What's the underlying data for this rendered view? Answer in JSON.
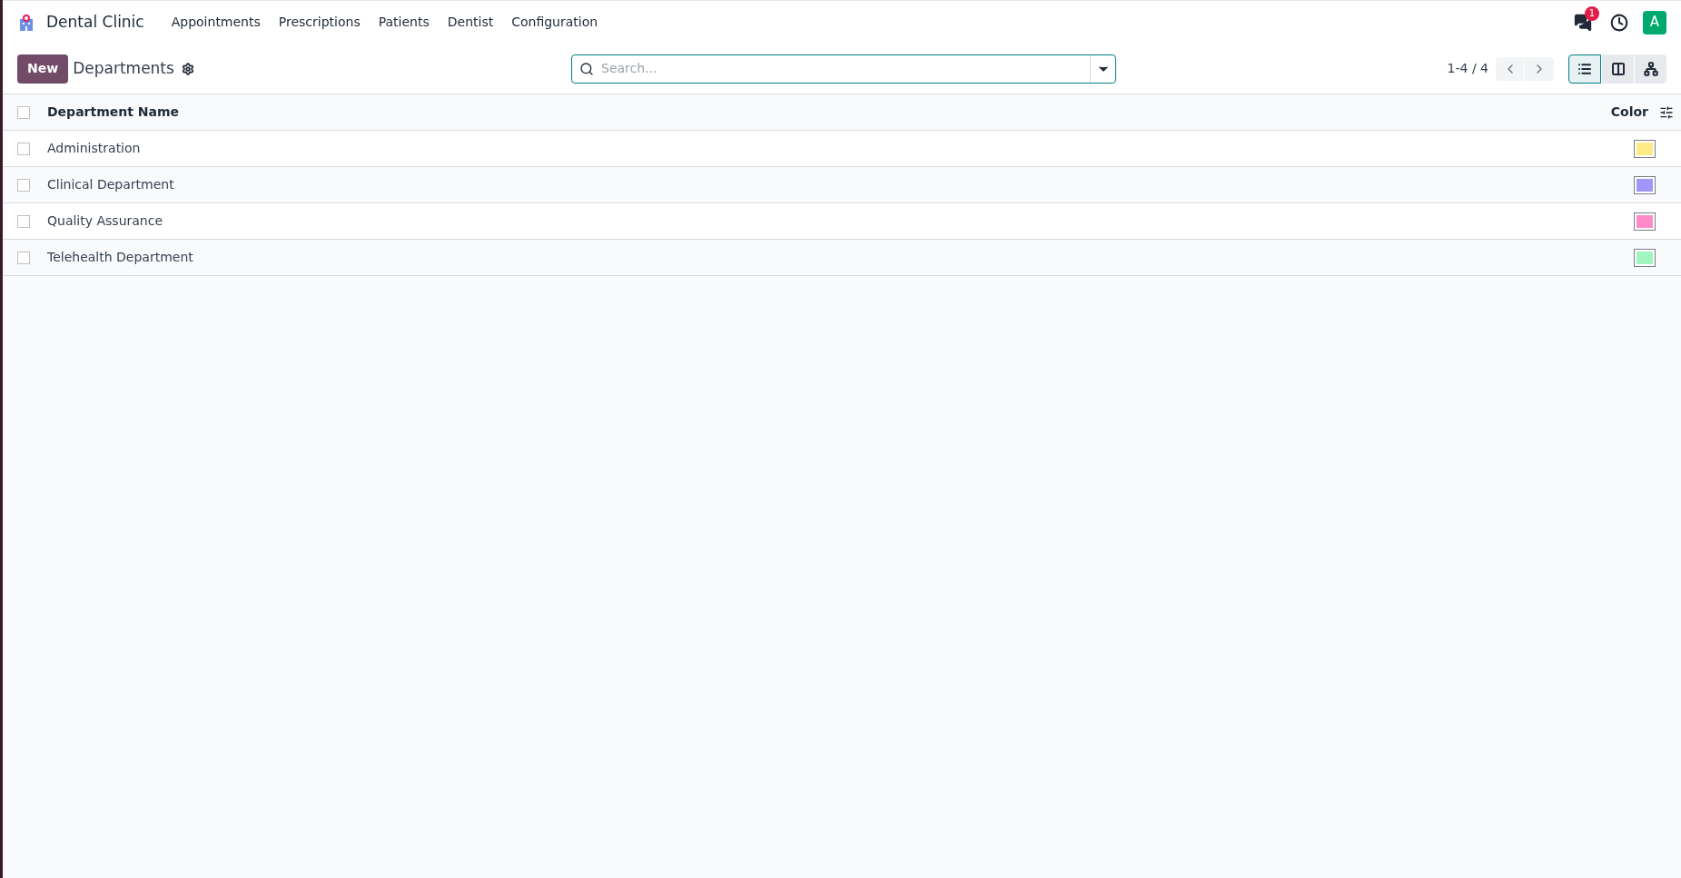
{
  "navbar": {
    "app_name": "Dental Clinic",
    "menu": [
      "Appointments",
      "Prescriptions",
      "Patients",
      "Dentist",
      "Configuration"
    ],
    "message_count": "1",
    "avatar": "A"
  },
  "control_panel": {
    "new_button": "New",
    "title": "Departments",
    "search": {
      "placeholder": "Search..."
    },
    "pager": "1-4 / 4",
    "views": [
      {
        "kind": "list",
        "selected": true
      },
      {
        "kind": "kanban",
        "selected": false
      },
      {
        "kind": "hierarchy",
        "selected": false
      }
    ]
  },
  "table": {
    "columns": [
      "Department Name",
      "Color"
    ],
    "header_checked": false,
    "rows": [
      {
        "name": "Administration",
        "checked": false,
        "color": "#ffeb85"
      },
      {
        "name": "Clinical Department",
        "checked": false,
        "color": "#a195fa"
      },
      {
        "name": "Quality Assurance",
        "checked": false,
        "color": "#ff8ac8"
      },
      {
        "name": "Telehealth Department",
        "checked": false,
        "color": "#a0f5c0"
      }
    ]
  }
}
